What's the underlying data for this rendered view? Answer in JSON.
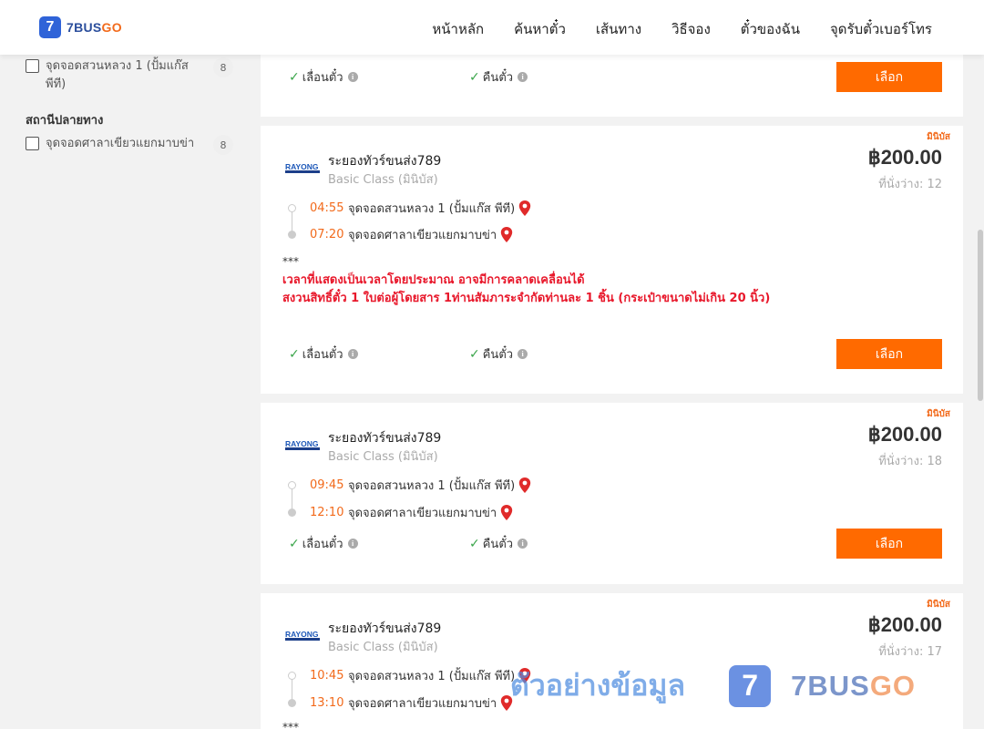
{
  "brand": {
    "logo_mark": "7",
    "name_part1": "7BUS",
    "name_part2": "GO",
    "accent": "#f26a1b",
    "primary": "#2f63d8"
  },
  "nav": [
    "หน้าหลัก",
    "ค้นหาตั๋ว",
    "เส้นทาง",
    "วิธีจอง",
    "ตั๋วของฉัน",
    "จุดรับตั๋วเบอร์โทร"
  ],
  "sidebar": {
    "origin_items": [
      {
        "label": "จุดจอดสวนหลวง 1 (ปั้มแก๊ส พีที)",
        "count": "8"
      }
    ],
    "destination_title": "สถานีปลายทาง",
    "destination_items": [
      {
        "label": "จุดจอดศาลาเขียวแยกมาบข่า",
        "count": "8"
      }
    ]
  },
  "options": {
    "change": "เลื่อนตั๋ว",
    "refund": "คืนตั๋ว",
    "select": "เลือก",
    "info_icon": "i",
    "check_icon": "✓"
  },
  "trips": [
    {
      "bus_type": "มินิบัส",
      "operator": "ระยองทัวร์ขนส่ง789",
      "operator_logo": "RAYONG",
      "class": "Basic Class (มินิบัส)",
      "price": "฿200.00",
      "seats": "ที่นั่งว่าง: 12",
      "depart_time": "04:55",
      "depart_place": "จุดจอดสวนหลวง 1 (ปั้มแก๊ส พีที)",
      "arrive_time": "07:20",
      "arrive_place": "จุดจอดศาลาเขียวแยกมาบข่า",
      "stars": "***",
      "note1": "เวลาที่แสดงเป็นเวลาโดยประมาณ อาจมีการคลาดเคลื่อนได้",
      "note2": "สงวนสิทธิ์ตั๋ว 1 ใบต่อผู้โดยสาร 1ท่านสัมภาระจำกัดท่านละ 1 ชิ้น (กระเป๋าขนาดไม่เกิน 20 นิ้ว)"
    },
    {
      "bus_type": "มินิบัส",
      "operator": "ระยองทัวร์ขนส่ง789",
      "operator_logo": "RAYONG",
      "class": "Basic Class (มินิบัส)",
      "price": "฿200.00",
      "seats": "ที่นั่งว่าง: 18",
      "depart_time": "09:45",
      "depart_place": "จุดจอดสวนหลวง 1 (ปั้มแก๊ส พีที)",
      "arrive_time": "12:10",
      "arrive_place": "จุดจอดศาลาเขียวแยกมาบข่า"
    },
    {
      "bus_type": "มินิบัส",
      "operator": "ระยองทัวร์ขนส่ง789",
      "operator_logo": "RAYONG",
      "class": "Basic Class (มินิบัส)",
      "price": "฿200.00",
      "seats": "ที่นั่งว่าง: 17",
      "depart_time": "10:45",
      "depart_place": "จุดจอดสวนหลวง 1 (ปั้มแก๊ส พีที)",
      "arrive_time": "13:10",
      "arrive_place": "จุดจอดศาลาเขียวแยกมาบข่า",
      "stars": "***"
    }
  ],
  "watermark": {
    "text": "ตัวอย่างข้อมูล",
    "mark": "7",
    "brand1": "7BUS",
    "brand2": "GO"
  }
}
